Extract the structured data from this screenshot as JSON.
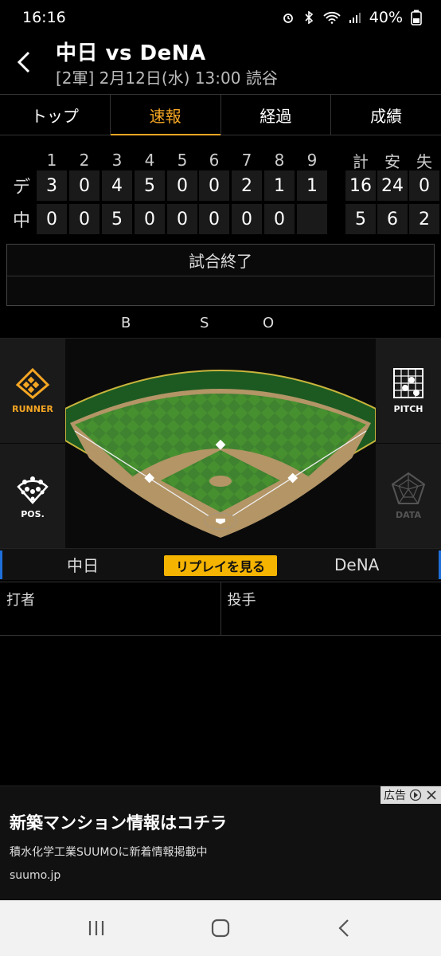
{
  "status_bar": {
    "time": "16:16",
    "battery": "40%"
  },
  "header": {
    "title": "中日 vs DeNA",
    "subtitle": "[2軍] 2月12日(水) 13:00 読谷"
  },
  "tabs": [
    {
      "label": "トップ",
      "active": false
    },
    {
      "label": "速報",
      "active": true
    },
    {
      "label": "経過",
      "active": false
    },
    {
      "label": "成績",
      "active": false
    }
  ],
  "scoreboard": {
    "innings": [
      "1",
      "2",
      "3",
      "4",
      "5",
      "6",
      "7",
      "8",
      "9"
    ],
    "totals_headers": [
      "計",
      "安",
      "失"
    ],
    "teams": [
      {
        "label": "デ",
        "runs": [
          "3",
          "0",
          "4",
          "5",
          "0",
          "0",
          "2",
          "1",
          "1"
        ],
        "totals": [
          "16",
          "24",
          "0"
        ]
      },
      {
        "label": "中",
        "runs": [
          "0",
          "0",
          "5",
          "0",
          "0",
          "0",
          "0",
          "0",
          ""
        ],
        "totals": [
          "5",
          "6",
          "2"
        ]
      }
    ]
  },
  "game_status": "試合終了",
  "bso": {
    "b": "B",
    "s": "S",
    "o": "O"
  },
  "side_buttons": {
    "runner": "RUNNER",
    "pos": "POS.",
    "pitch": "PITCH",
    "data": "DATA"
  },
  "teams_row": {
    "home": "中日",
    "away": "DeNA",
    "replay": "リプレイを見る"
  },
  "matchup": {
    "batter": "打者",
    "pitcher": "投手"
  },
  "ad": {
    "tag": "広告",
    "title": "新築マンション情報はコチラ",
    "desc": "積水化学工業SUUMOに新着情報掲載中",
    "url": "suumo.jp"
  },
  "colors": {
    "accent": "#f5a623",
    "replay": "#f5b400",
    "grass": "#3e7f2d",
    "dirt": "#b89a6a"
  }
}
